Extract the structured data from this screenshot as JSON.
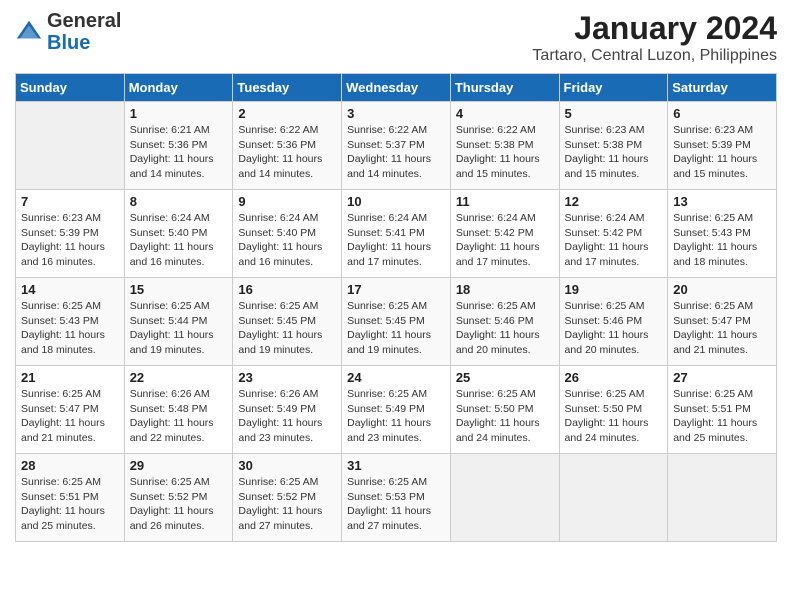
{
  "logo": {
    "general": "General",
    "blue": "Blue"
  },
  "header": {
    "month_year": "January 2024",
    "location": "Tartaro, Central Luzon, Philippines"
  },
  "days_of_week": [
    "Sunday",
    "Monday",
    "Tuesday",
    "Wednesday",
    "Thursday",
    "Friday",
    "Saturday"
  ],
  "weeks": [
    [
      {
        "day": "",
        "sunrise": "",
        "sunset": "",
        "daylight": ""
      },
      {
        "day": "1",
        "sunrise": "Sunrise: 6:21 AM",
        "sunset": "Sunset: 5:36 PM",
        "daylight": "Daylight: 11 hours and 14 minutes."
      },
      {
        "day": "2",
        "sunrise": "Sunrise: 6:22 AM",
        "sunset": "Sunset: 5:36 PM",
        "daylight": "Daylight: 11 hours and 14 minutes."
      },
      {
        "day": "3",
        "sunrise": "Sunrise: 6:22 AM",
        "sunset": "Sunset: 5:37 PM",
        "daylight": "Daylight: 11 hours and 14 minutes."
      },
      {
        "day": "4",
        "sunrise": "Sunrise: 6:22 AM",
        "sunset": "Sunset: 5:38 PM",
        "daylight": "Daylight: 11 hours and 15 minutes."
      },
      {
        "day": "5",
        "sunrise": "Sunrise: 6:23 AM",
        "sunset": "Sunset: 5:38 PM",
        "daylight": "Daylight: 11 hours and 15 minutes."
      },
      {
        "day": "6",
        "sunrise": "Sunrise: 6:23 AM",
        "sunset": "Sunset: 5:39 PM",
        "daylight": "Daylight: 11 hours and 15 minutes."
      }
    ],
    [
      {
        "day": "7",
        "sunrise": "Sunrise: 6:23 AM",
        "sunset": "Sunset: 5:39 PM",
        "daylight": "Daylight: 11 hours and 16 minutes."
      },
      {
        "day": "8",
        "sunrise": "Sunrise: 6:24 AM",
        "sunset": "Sunset: 5:40 PM",
        "daylight": "Daylight: 11 hours and 16 minutes."
      },
      {
        "day": "9",
        "sunrise": "Sunrise: 6:24 AM",
        "sunset": "Sunset: 5:40 PM",
        "daylight": "Daylight: 11 hours and 16 minutes."
      },
      {
        "day": "10",
        "sunrise": "Sunrise: 6:24 AM",
        "sunset": "Sunset: 5:41 PM",
        "daylight": "Daylight: 11 hours and 17 minutes."
      },
      {
        "day": "11",
        "sunrise": "Sunrise: 6:24 AM",
        "sunset": "Sunset: 5:42 PM",
        "daylight": "Daylight: 11 hours and 17 minutes."
      },
      {
        "day": "12",
        "sunrise": "Sunrise: 6:24 AM",
        "sunset": "Sunset: 5:42 PM",
        "daylight": "Daylight: 11 hours and 17 minutes."
      },
      {
        "day": "13",
        "sunrise": "Sunrise: 6:25 AM",
        "sunset": "Sunset: 5:43 PM",
        "daylight": "Daylight: 11 hours and 18 minutes."
      }
    ],
    [
      {
        "day": "14",
        "sunrise": "Sunrise: 6:25 AM",
        "sunset": "Sunset: 5:43 PM",
        "daylight": "Daylight: 11 hours and 18 minutes."
      },
      {
        "day": "15",
        "sunrise": "Sunrise: 6:25 AM",
        "sunset": "Sunset: 5:44 PM",
        "daylight": "Daylight: 11 hours and 19 minutes."
      },
      {
        "day": "16",
        "sunrise": "Sunrise: 6:25 AM",
        "sunset": "Sunset: 5:45 PM",
        "daylight": "Daylight: 11 hours and 19 minutes."
      },
      {
        "day": "17",
        "sunrise": "Sunrise: 6:25 AM",
        "sunset": "Sunset: 5:45 PM",
        "daylight": "Daylight: 11 hours and 19 minutes."
      },
      {
        "day": "18",
        "sunrise": "Sunrise: 6:25 AM",
        "sunset": "Sunset: 5:46 PM",
        "daylight": "Daylight: 11 hours and 20 minutes."
      },
      {
        "day": "19",
        "sunrise": "Sunrise: 6:25 AM",
        "sunset": "Sunset: 5:46 PM",
        "daylight": "Daylight: 11 hours and 20 minutes."
      },
      {
        "day": "20",
        "sunrise": "Sunrise: 6:25 AM",
        "sunset": "Sunset: 5:47 PM",
        "daylight": "Daylight: 11 hours and 21 minutes."
      }
    ],
    [
      {
        "day": "21",
        "sunrise": "Sunrise: 6:25 AM",
        "sunset": "Sunset: 5:47 PM",
        "daylight": "Daylight: 11 hours and 21 minutes."
      },
      {
        "day": "22",
        "sunrise": "Sunrise: 6:26 AM",
        "sunset": "Sunset: 5:48 PM",
        "daylight": "Daylight: 11 hours and 22 minutes."
      },
      {
        "day": "23",
        "sunrise": "Sunrise: 6:26 AM",
        "sunset": "Sunset: 5:49 PM",
        "daylight": "Daylight: 11 hours and 23 minutes."
      },
      {
        "day": "24",
        "sunrise": "Sunrise: 6:25 AM",
        "sunset": "Sunset: 5:49 PM",
        "daylight": "Daylight: 11 hours and 23 minutes."
      },
      {
        "day": "25",
        "sunrise": "Sunrise: 6:25 AM",
        "sunset": "Sunset: 5:50 PM",
        "daylight": "Daylight: 11 hours and 24 minutes."
      },
      {
        "day": "26",
        "sunrise": "Sunrise: 6:25 AM",
        "sunset": "Sunset: 5:50 PM",
        "daylight": "Daylight: 11 hours and 24 minutes."
      },
      {
        "day": "27",
        "sunrise": "Sunrise: 6:25 AM",
        "sunset": "Sunset: 5:51 PM",
        "daylight": "Daylight: 11 hours and 25 minutes."
      }
    ],
    [
      {
        "day": "28",
        "sunrise": "Sunrise: 6:25 AM",
        "sunset": "Sunset: 5:51 PM",
        "daylight": "Daylight: 11 hours and 25 minutes."
      },
      {
        "day": "29",
        "sunrise": "Sunrise: 6:25 AM",
        "sunset": "Sunset: 5:52 PM",
        "daylight": "Daylight: 11 hours and 26 minutes."
      },
      {
        "day": "30",
        "sunrise": "Sunrise: 6:25 AM",
        "sunset": "Sunset: 5:52 PM",
        "daylight": "Daylight: 11 hours and 27 minutes."
      },
      {
        "day": "31",
        "sunrise": "Sunrise: 6:25 AM",
        "sunset": "Sunset: 5:53 PM",
        "daylight": "Daylight: 11 hours and 27 minutes."
      },
      {
        "day": "",
        "sunrise": "",
        "sunset": "",
        "daylight": ""
      },
      {
        "day": "",
        "sunrise": "",
        "sunset": "",
        "daylight": ""
      },
      {
        "day": "",
        "sunrise": "",
        "sunset": "",
        "daylight": ""
      }
    ]
  ]
}
